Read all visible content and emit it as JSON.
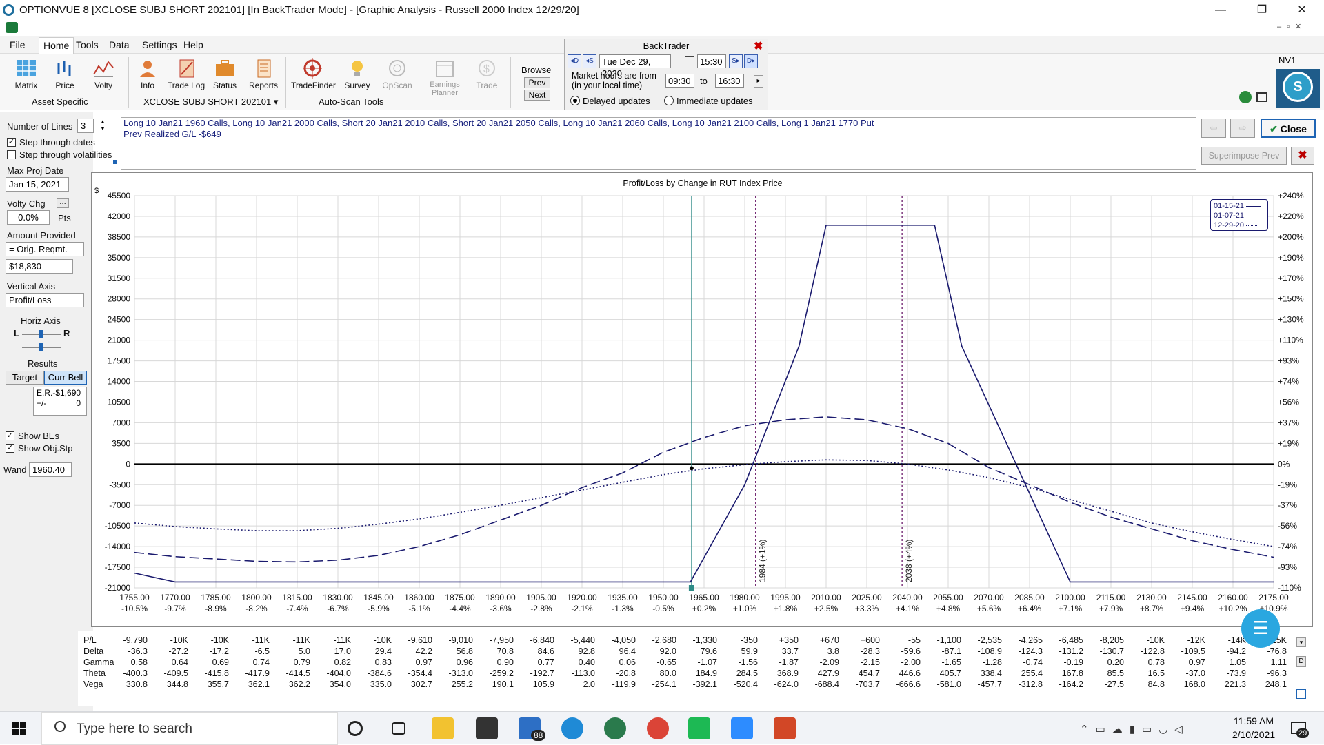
{
  "window": {
    "title": "OPTIONVUE 8   [XCLOSE SUBJ SHORT 202101]   [In BackTrader Mode] - [Graphic Analysis - Russell 2000 Index  12/29/20]",
    "minimize": "—",
    "restore": "❐",
    "close": "✕"
  },
  "menu": [
    "File",
    "Home",
    "Tools",
    "Data",
    "Settings",
    "Help"
  ],
  "ribbon": {
    "asset_specific": {
      "label": "Asset Specific",
      "buttons": [
        "Matrix",
        "Price",
        "Volty"
      ]
    },
    "subj": {
      "label": "XCLOSE SUBJ SHORT 202101 ▾",
      "buttons": [
        "Info",
        "Trade Log",
        "Status",
        "Reports"
      ]
    },
    "autoscan": {
      "label": "Auto-Scan Tools",
      "buttons": [
        "TradeFinder",
        "Survey",
        "OpScan"
      ]
    },
    "other": {
      "buttons": [
        "Earnings Planner",
        "Trade"
      ]
    },
    "browse": {
      "label": "Browse",
      "prev": "Prev",
      "next": "Next"
    },
    "nv": "NV1"
  },
  "backtrader": {
    "title": "BackTrader",
    "date": "Tue Dec 29, 2020",
    "time": "15:30",
    "market_hours_label_1": "Market hours are from",
    "market_hours_label_2": "(in your local time)",
    "from": "09:30",
    "to_label": "to",
    "to": "16:30",
    "delayed": "Delayed updates",
    "immediate": "Immediate updates"
  },
  "left": {
    "num_lines_label": "Number of Lines",
    "num_lines": "3",
    "step_dates": "Step through dates",
    "step_vols": "Step through volatilities",
    "max_proj_label": "Max Proj Date",
    "max_proj": "Jan 15, 2021",
    "volty_chg_label": "Volty Chg",
    "volty_chg": "0.0%",
    "pts": "Pts",
    "amount_label": "Amount Provided",
    "amount_sel": "= Orig. Reqmt.",
    "amount": "$18,830",
    "vertical_label": "Vertical Axis",
    "vertical_sel": "Profit/Loss",
    "horiz_label": "Horiz Axis",
    "L": "L",
    "R": "R",
    "results_label": "Results",
    "target": "Target",
    "curr_bell": "Curr Bell",
    "er": "E.R.-$1,690",
    "pm": "+/-",
    "pm_val": "0",
    "show_bes": "Show BEs",
    "show_obj": "Show Obj.Stp",
    "wand_label": "Wand",
    "wand": "1960.40"
  },
  "positions": {
    "line1": "Long 10 Jan21 1960 Calls, Long 10 Jan21 2000 Calls, Short 20 Jan21 2010 Calls, Short 20 Jan21 2050 Calls, Long 10 Jan21 2060 Calls, Long 10 Jan21 2100 Calls, Long 1 Jan21 1770 Put",
    "line2": "Prev Realized G/L -$649"
  },
  "right_buttons": {
    "close": "Close",
    "superimpose": "Superimpose Prev"
  },
  "chart_data": {
    "type": "line",
    "title": "Profit/Loss by Change in RUT Index Price",
    "ylabel": "$",
    "ylim": [
      -21000,
      45500
    ],
    "yticks": [
      45500,
      42000,
      38500,
      35000,
      31500,
      28000,
      24500,
      21000,
      17500,
      14000,
      10500,
      7000,
      3500,
      0,
      -3500,
      -7000,
      -10500,
      -14000,
      -17500,
      -21000
    ],
    "yticks_right": [
      "+240%",
      "+220%",
      "+200%",
      "+190%",
      "+170%",
      "+150%",
      "+130%",
      "+110%",
      "+93%",
      "+74%",
      "+56%",
      "+37%",
      "+19%",
      "0%",
      "-19%",
      "-37%",
      "-56%",
      "-74%",
      "-93%",
      "-110%"
    ],
    "xlim": [
      1755,
      2175
    ],
    "xticks": [
      1755,
      1770,
      1785,
      1800,
      1815,
      1830,
      1845,
      1860,
      1875,
      1890,
      1905,
      1920,
      1935,
      1950,
      1965,
      1980,
      1995,
      2010,
      2025,
      2040,
      2055,
      2070,
      2085,
      2100,
      2115,
      2130,
      2145,
      2160,
      2175
    ],
    "xticks_pct": [
      "-10.5%",
      "-9.7%",
      "-8.9%",
      "-8.2%",
      "-7.4%",
      "-6.7%",
      "-5.9%",
      "-5.1%",
      "-4.4%",
      "-3.6%",
      "-2.8%",
      "-2.1%",
      "-1.3%",
      "-0.5%",
      "+0.2%",
      "+1.0%",
      "+1.8%",
      "+2.5%",
      "+3.3%",
      "+4.1%",
      "+4.8%",
      "+5.6%",
      "+6.4%",
      "+7.1%",
      "+7.9%",
      "+8.7%",
      "+9.4%",
      "+10.2%",
      "+10.9%"
    ],
    "vlines": [
      {
        "x": 1984,
        "label": "1984 (+1%)"
      },
      {
        "x": 2038,
        "label": "2038 (+4%)"
      }
    ],
    "wand_x": 1960.4,
    "legend": [
      "01-15-21",
      "01-07-21",
      "12-29-20"
    ],
    "series": [
      {
        "name": "01-15-21",
        "style": "solid",
        "x": [
          1755,
          1770,
          1800,
          1850,
          1900,
          1960,
          1980,
          2000,
          2010,
          2050,
          2060,
          2100,
          2175
        ],
        "y": [
          -18500,
          -20000,
          -20000,
          -20000,
          -20000,
          -20000,
          -3500,
          20000,
          40500,
          40500,
          20000,
          -20000,
          -20000
        ]
      },
      {
        "name": "01-07-21",
        "style": "dashed",
        "x": [
          1755,
          1770,
          1800,
          1815,
          1830,
          1845,
          1860,
          1875,
          1890,
          1905,
          1920,
          1935,
          1950,
          1965,
          1980,
          1995,
          2010,
          2025,
          2040,
          2055,
          2070,
          2085,
          2100,
          2115,
          2130,
          2145,
          2160,
          2175
        ],
        "y": [
          -15000,
          -15700,
          -16500,
          -16600,
          -16300,
          -15500,
          -14000,
          -12000,
          -9500,
          -7000,
          -4000,
          -1500,
          2000,
          4500,
          6500,
          7500,
          8000,
          7500,
          6000,
          3500,
          -600,
          -3500,
          -6500,
          -9000,
          -11000,
          -13000,
          -14500,
          -15800
        ]
      },
      {
        "name": "12-29-20",
        "style": "dotted",
        "x": [
          1755,
          1770,
          1785,
          1800,
          1815,
          1830,
          1845,
          1860,
          1875,
          1890,
          1905,
          1920,
          1935,
          1950,
          1965,
          1980,
          1995,
          2010,
          2025,
          2040,
          2055,
          2070,
          2085,
          2100,
          2115,
          2130,
          2145,
          2160,
          2175
        ],
        "y": [
          -10000,
          -10600,
          -11000,
          -11300,
          -11300,
          -10900,
          -10200,
          -9300,
          -8200,
          -7000,
          -5700,
          -4400,
          -3100,
          -1800,
          -800,
          -100,
          400,
          700,
          600,
          0,
          -1000,
          -2300,
          -4000,
          -6000,
          -8000,
          -10000,
          -11500,
          -12800,
          -14000
        ]
      }
    ]
  },
  "greeks": {
    "rows": [
      {
        "label": "P/L",
        "values": [
          "-9,790",
          "-10K",
          "-10K",
          "-11K",
          "-11K",
          "-11K",
          "-10K",
          "-9,610",
          "-9,010",
          "-7,950",
          "-6,840",
          "-5,440",
          "-4,050",
          "-2,680",
          "-1,330",
          "-350",
          "+350",
          "+670",
          "+600",
          "-55",
          "-1,100",
          "-2,535",
          "-4,265",
          "-6,485",
          "-8,205",
          "-10K",
          "-12K",
          "-14K",
          "-15K"
        ]
      },
      {
        "label": "Delta",
        "values": [
          "-36.3",
          "-27.2",
          "-17.2",
          "-6.5",
          "5.0",
          "17.0",
          "29.4",
          "42.2",
          "56.8",
          "70.8",
          "84.6",
          "92.8",
          "96.4",
          "92.0",
          "79.6",
          "59.9",
          "33.7",
          "3.8",
          "-28.3",
          "-59.6",
          "-87.1",
          "-108.9",
          "-124.3",
          "-131.2",
          "-130.7",
          "-122.8",
          "-109.5",
          "-94.2",
          "-76.8"
        ]
      },
      {
        "label": "Gamma",
        "values": [
          "0.58",
          "0.64",
          "0.69",
          "0.74",
          "0.79",
          "0.82",
          "0.83",
          "0.97",
          "0.96",
          "0.90",
          "0.77",
          "0.40",
          "0.06",
          "-0.65",
          "-1.07",
          "-1.56",
          "-1.87",
          "-2.09",
          "-2.15",
          "-2.00",
          "-1.65",
          "-1.28",
          "-0.74",
          "-0.19",
          "0.20",
          "0.78",
          "0.97",
          "1.05",
          "1.11"
        ]
      },
      {
        "label": "Theta",
        "values": [
          "-400.3",
          "-409.5",
          "-415.8",
          "-417.9",
          "-414.5",
          "-404.0",
          "-384.6",
          "-354.4",
          "-313.0",
          "-259.2",
          "-192.7",
          "-113.0",
          "-20.8",
          "80.0",
          "184.9",
          "284.5",
          "368.9",
          "427.9",
          "454.7",
          "446.6",
          "405.7",
          "338.4",
          "255.4",
          "167.8",
          "85.5",
          "16.5",
          "-37.0",
          "-73.9",
          "-96.3"
        ]
      },
      {
        "label": "Vega",
        "values": [
          "330.8",
          "344.8",
          "355.7",
          "362.1",
          "362.2",
          "354.0",
          "335.0",
          "302.7",
          "255.2",
          "190.1",
          "105.9",
          "2.0",
          "-119.9",
          "-254.1",
          "-392.1",
          "-520.4",
          "-624.0",
          "-688.4",
          "-703.7",
          "-666.6",
          "-581.0",
          "-457.7",
          "-312.8",
          "-164.2",
          "-27.5",
          "84.8",
          "168.0",
          "221.3",
          "248.1"
        ]
      }
    ]
  },
  "taskbar": {
    "search_placeholder": "Type here to search",
    "time": "11:59 AM",
    "date": "2/10/2021",
    "mail_badge": "88",
    "notif_badge": "29"
  },
  "colors": {
    "navy": "#1a1a6e",
    "accent": "#1c3e9a",
    "teal": "#2e8b87",
    "purple": "#6a1b6a"
  }
}
